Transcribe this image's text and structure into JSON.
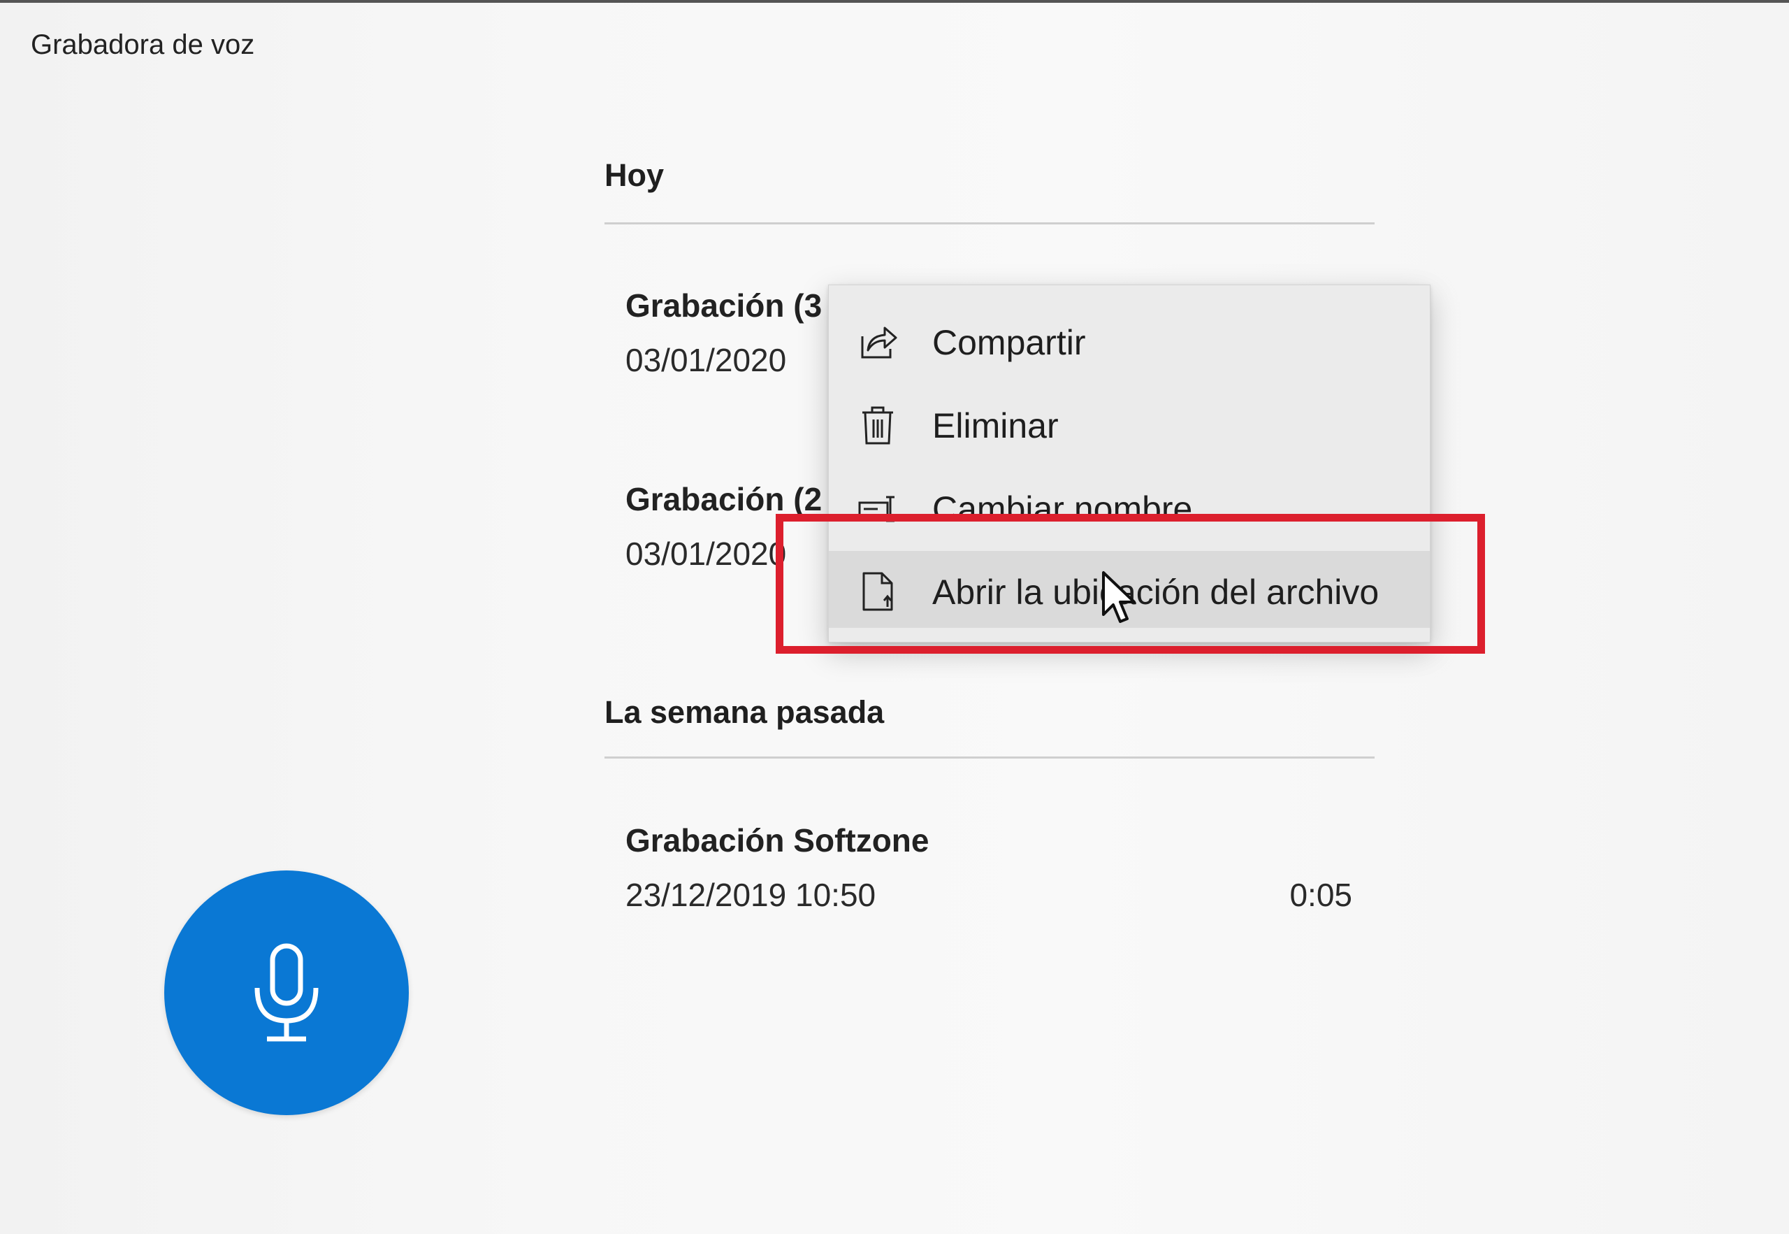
{
  "app": {
    "title": "Grabadora de voz"
  },
  "sections": {
    "today": {
      "title": "Hoy",
      "recordings": [
        {
          "name": "Grabación (3",
          "date": "03/01/2020"
        },
        {
          "name": "Grabación (2",
          "date": "03/01/2020"
        }
      ]
    },
    "last_week": {
      "title": "La semana pasada",
      "recordings": [
        {
          "name": "Grabación Softzone",
          "date": "23/12/2019 10:50",
          "duration": "0:05"
        }
      ]
    }
  },
  "context_menu": {
    "items": [
      {
        "label": "Compartir",
        "icon": "share-icon"
      },
      {
        "label": "Eliminar",
        "icon": "trash-icon"
      },
      {
        "label": "Cambiar nombre",
        "icon": "rename-icon"
      },
      {
        "label": "Abrir la ubicación del archivo",
        "icon": "open-file-location-icon",
        "hovered": true
      }
    ]
  },
  "record_button": {
    "icon": "microphone-icon",
    "color": "#0a78d4"
  },
  "colors": {
    "accent": "#0a78d4",
    "annotation": "#dc1f2d",
    "menu_background": "#ebebeb",
    "menu_hover": "#dadada"
  }
}
